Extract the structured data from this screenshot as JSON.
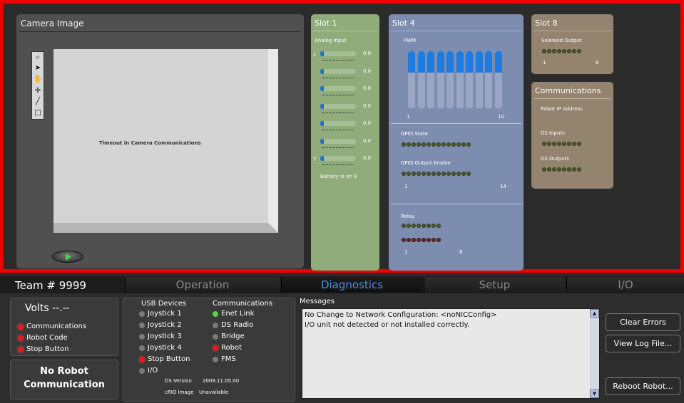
{
  "camera": {
    "title": "Camera Image",
    "status": "Timeout in Camera Communications"
  },
  "slot1": {
    "title": "Slot 1",
    "label": "Analog Input",
    "first_channel": "1",
    "last_channel": "7",
    "values": [
      "0.0",
      "0.0",
      "0.0",
      "0.0",
      "0.0",
      "0.0",
      "0.0"
    ],
    "battery_note": "Battery is on 8"
  },
  "slot4": {
    "title": "Slot 4",
    "pwm_label": "PWM",
    "pwm_min": "1",
    "pwm_max": "10",
    "gpio_state_label": "GPIO State",
    "gpio_output_label": "GPIO Output Enable",
    "gpio_min": "1",
    "gpio_max": "14",
    "relay_label": "Relay",
    "relay_min": "1",
    "relay_max": "8"
  },
  "slot8": {
    "title": "Slot 8",
    "label": "Solenoid Output",
    "min": "1",
    "max": "8"
  },
  "communications": {
    "title": "Communications",
    "ip_label": "Robot IP Address",
    "ds_inputs_label": "DS Inputs",
    "ds_outputs_label": "DS Outputs"
  },
  "tabs": {
    "team": "Team # 9999",
    "items": [
      "Operation",
      "Diagnostics",
      "Setup",
      "I/O"
    ],
    "active": "Diagnostics"
  },
  "status": {
    "volts": "Volts  --.--",
    "indicators": [
      "Communications",
      "Robot Code",
      "Stop Button"
    ],
    "no_robot_line1": "No Robot",
    "no_robot_line2": "Communication"
  },
  "usb": {
    "title": "USB Devices",
    "items": [
      "Joystick 1",
      "Joystick 2",
      "Joystick 3",
      "Joystick 4",
      "Stop Button",
      "I/O"
    ]
  },
  "comms": {
    "title": "Communications",
    "items": [
      "Enet Link",
      "DS Radio",
      "Bridge",
      "Robot",
      "FMS"
    ]
  },
  "versions": {
    "ds_label": "DS Version",
    "ds_value": "2009.11.05.00",
    "crio_label": "cRIO Image",
    "crio_value": "Unavailable"
  },
  "messages": {
    "title": "Messages",
    "lines": [
      "No Change to Network Configuration: <noNICConfig>",
      "I/O unit not detected or not installed correctly."
    ]
  },
  "buttons": {
    "clear": "Clear Errors",
    "log": "View Log File...",
    "reboot": "Reboot Robot..."
  },
  "colors": {
    "accent_border": "#e00000",
    "active_tab": "#4a8fe0",
    "slot1_bg": "#8fac7a",
    "slot4_bg": "#7d8db0",
    "slot8_bg": "#93836f"
  }
}
